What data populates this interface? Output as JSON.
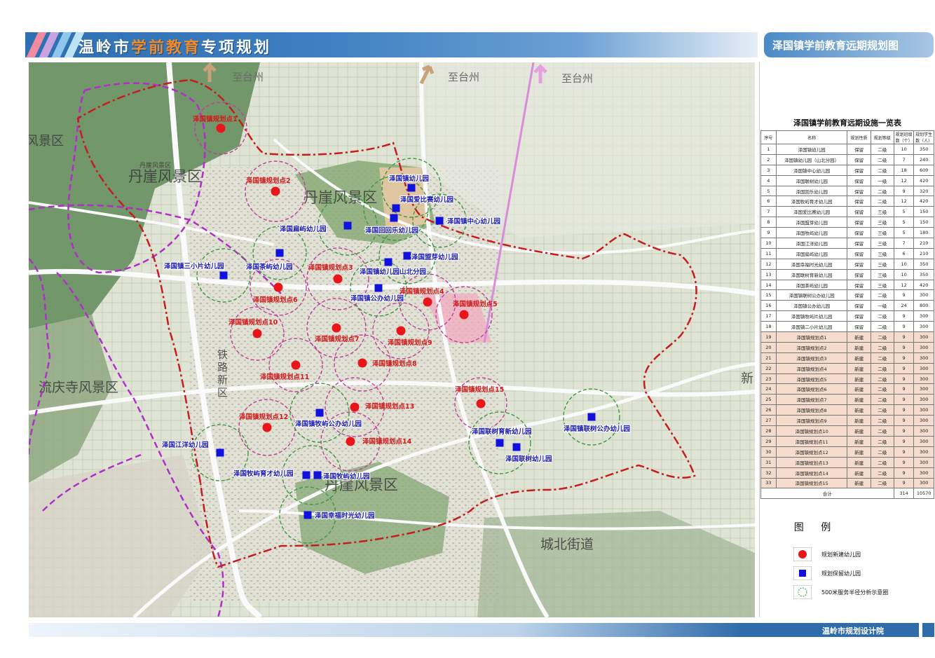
{
  "header": {
    "title_part1": "温岭市",
    "title_part2": "学前教育",
    "title_part3": "专项规划"
  },
  "map_title": "泽国镇学前教育远期规划图",
  "map": {
    "directions": [
      "至台州",
      "至台州",
      "至台州"
    ],
    "areas": [
      {
        "id": "a1",
        "text": "风景区"
      },
      {
        "id": "a2",
        "text": "丹崖风景区"
      },
      {
        "id": "a3",
        "text": "丹崖风景区"
      },
      {
        "id": "a4",
        "text": "丹崖风景区"
      },
      {
        "id": "a5",
        "text": "流庆寺风景区"
      },
      {
        "id": "a6",
        "text": "城北街道"
      },
      {
        "id": "a7",
        "text": "铁"
      },
      {
        "id": "a8",
        "text": "路"
      },
      {
        "id": "a9",
        "text": "新"
      },
      {
        "id": "a10",
        "text": "区"
      },
      {
        "id": "a11",
        "text": "新"
      },
      {
        "id": "a12",
        "text": "丹崖风景区"
      }
    ],
    "new_kindergartens": [
      {
        "label": "泽国镇规划点1"
      },
      {
        "label": "泽国镇规划点2"
      },
      {
        "label": "泽国镇规划点3"
      },
      {
        "label": "泽国镇规划点4"
      },
      {
        "label": "泽国镇规划点5"
      },
      {
        "label": "泽国镇规划点6"
      },
      {
        "label": "泽国镇规划点7"
      },
      {
        "label": "泽国镇规划点8"
      },
      {
        "label": "泽国镇规划点9"
      },
      {
        "label": "泽国镇规划点10"
      },
      {
        "label": "泽国镇规划点11"
      },
      {
        "label": "泽国镇规划点12"
      },
      {
        "label": "泽国镇规划点13"
      },
      {
        "label": "泽国镇规划点14"
      },
      {
        "label": "泽国镇规划点15"
      }
    ],
    "kept_kindergartens": [
      {
        "label": "泽国镇幼儿园"
      },
      {
        "label": "泽国爱比赛幼儿园"
      },
      {
        "label": "泽国回回乐幼儿园"
      },
      {
        "label": "泽国镇中心幼儿园"
      },
      {
        "label": "泽国扁屿幼儿园"
      },
      {
        "label": "泽国盟芽幼儿园"
      },
      {
        "label": "泽国茶屿幼儿园"
      },
      {
        "label": "泽国镇幼儿园山北分园"
      },
      {
        "label": "泽国镇三小片幼儿园"
      },
      {
        "label": "泽国镇公办幼儿园"
      },
      {
        "label": "泽国镇牧屿公办幼儿园"
      },
      {
        "label": "泽国联树育新幼儿园"
      },
      {
        "label": "泽国联树幼儿园"
      },
      {
        "label": "泽国镇联树公办幼儿园"
      },
      {
        "label": "泽国江洋幼儿园"
      },
      {
        "label": "泽国牧屿育才幼儿园"
      },
      {
        "label": "泽国牧屿幼儿园"
      },
      {
        "label": "泽国幸福时光幼儿园"
      }
    ]
  },
  "table": {
    "title": "泽国镇学前教育远期设施一览表",
    "headers": [
      "序号",
      "名称",
      "规划性质",
      "规划等级",
      "规划班级数（个）",
      "规划学生数（人）"
    ],
    "rows": [
      [
        "1",
        "泽国镇幼儿园",
        "保留",
        "二级",
        "10",
        "350"
      ],
      [
        "2",
        "泽国镇幼儿园（山北分园）",
        "保留",
        "二级",
        "7",
        "240"
      ],
      [
        "3",
        "泽国镇中心幼儿园",
        "保留",
        "二级",
        "18",
        "600"
      ],
      [
        "4",
        "泽国联树幼儿园",
        "保留",
        "一级",
        "12",
        "420"
      ],
      [
        "5",
        "泽国回乐幼儿园",
        "保留",
        "二级",
        "9",
        "320"
      ],
      [
        "6",
        "泽国牧屿育才幼儿园",
        "保留",
        "二级",
        "12",
        "420"
      ],
      [
        "7",
        "泽国爱比赛幼儿园",
        "保留",
        "三级",
        "5",
        "150"
      ],
      [
        "8",
        "泽国盟芽幼儿园",
        "保留",
        "三级",
        "5",
        "150"
      ],
      [
        "9",
        "泽国牧屿幼儿园",
        "保留",
        "三级",
        "5",
        "180"
      ],
      [
        "10",
        "泽国江洋幼儿园",
        "保留",
        "三级",
        "7",
        "210"
      ],
      [
        "11",
        "泽国扁屿幼儿园",
        "保留",
        "三级",
        "6",
        "210"
      ],
      [
        "12",
        "泽国幸福时光幼儿园",
        "保留",
        "三级",
        "10",
        "350"
      ],
      [
        "13",
        "泽国联树育新幼儿园",
        "保留",
        "三级",
        "10",
        "350"
      ],
      [
        "14",
        "泽国茶屿幼儿园",
        "保留",
        "三级",
        "12",
        "420"
      ],
      [
        "15",
        "泽国镇联树公办幼儿园",
        "保留",
        "二级",
        "9",
        "300"
      ],
      [
        "16",
        "泽国镇公办幼儿园",
        "保留",
        "一级",
        "24",
        "800"
      ],
      [
        "17",
        "泽国镇牧屿片幼儿园",
        "保留",
        "二级",
        "9",
        "300"
      ],
      [
        "18",
        "泽国镇二小片幼儿园",
        "保留",
        "二级",
        "9",
        "300"
      ],
      [
        "19",
        "泽国镇规划点1",
        "新建",
        "二级",
        "9",
        "300"
      ],
      [
        "20",
        "泽国镇规划点2",
        "新建",
        "二级",
        "9",
        "300"
      ],
      [
        "21",
        "泽国镇规划点3",
        "新建",
        "二级",
        "9",
        "300"
      ],
      [
        "22",
        "泽国镇规划点4",
        "新建",
        "二级",
        "9",
        "300"
      ],
      [
        "23",
        "泽国镇规划点5",
        "新建",
        "二级",
        "9",
        "300"
      ],
      [
        "24",
        "泽国镇规划点6",
        "新建",
        "二级",
        "9",
        "300"
      ],
      [
        "25",
        "泽国镇规划点7",
        "新建",
        "二级",
        "9",
        "300"
      ],
      [
        "26",
        "泽国镇规划点8",
        "新建",
        "二级",
        "9",
        "300"
      ],
      [
        "27",
        "泽国镇规划点9",
        "新建",
        "二级",
        "9",
        "300"
      ],
      [
        "28",
        "泽国镇规划点10",
        "新建",
        "二级",
        "9",
        "300"
      ],
      [
        "29",
        "泽国镇规划点11",
        "新建",
        "二级",
        "9",
        "300"
      ],
      [
        "30",
        "泽国镇规划点12",
        "新建",
        "二级",
        "9",
        "300"
      ],
      [
        "31",
        "泽国镇规划点13",
        "新建",
        "二级",
        "9",
        "300"
      ],
      [
        "32",
        "泽国镇规划点14",
        "新建",
        "二级",
        "9",
        "300"
      ],
      [
        "33",
        "泽国镇规划点15",
        "新建",
        "二级",
        "9",
        "300"
      ]
    ],
    "total": [
      "合计",
      "314",
      "10570"
    ]
  },
  "legend": {
    "title": "图 例",
    "items": [
      {
        "label": "规划新建幼儿园",
        "color": "#e8161b"
      },
      {
        "label": "规划保留幼儿园",
        "color": "#1111dd"
      },
      {
        "label": "500米服务半径分析示意圈",
        "color": "#3a9a3a"
      }
    ]
  },
  "footer": {
    "org": "温岭市规划设计院"
  },
  "colors": {
    "new": "#e8161b",
    "kept": "#1111dd",
    "boundary": "#c41e1e",
    "scenic": "#b12ec8",
    "header": "#2d6fb0"
  }
}
